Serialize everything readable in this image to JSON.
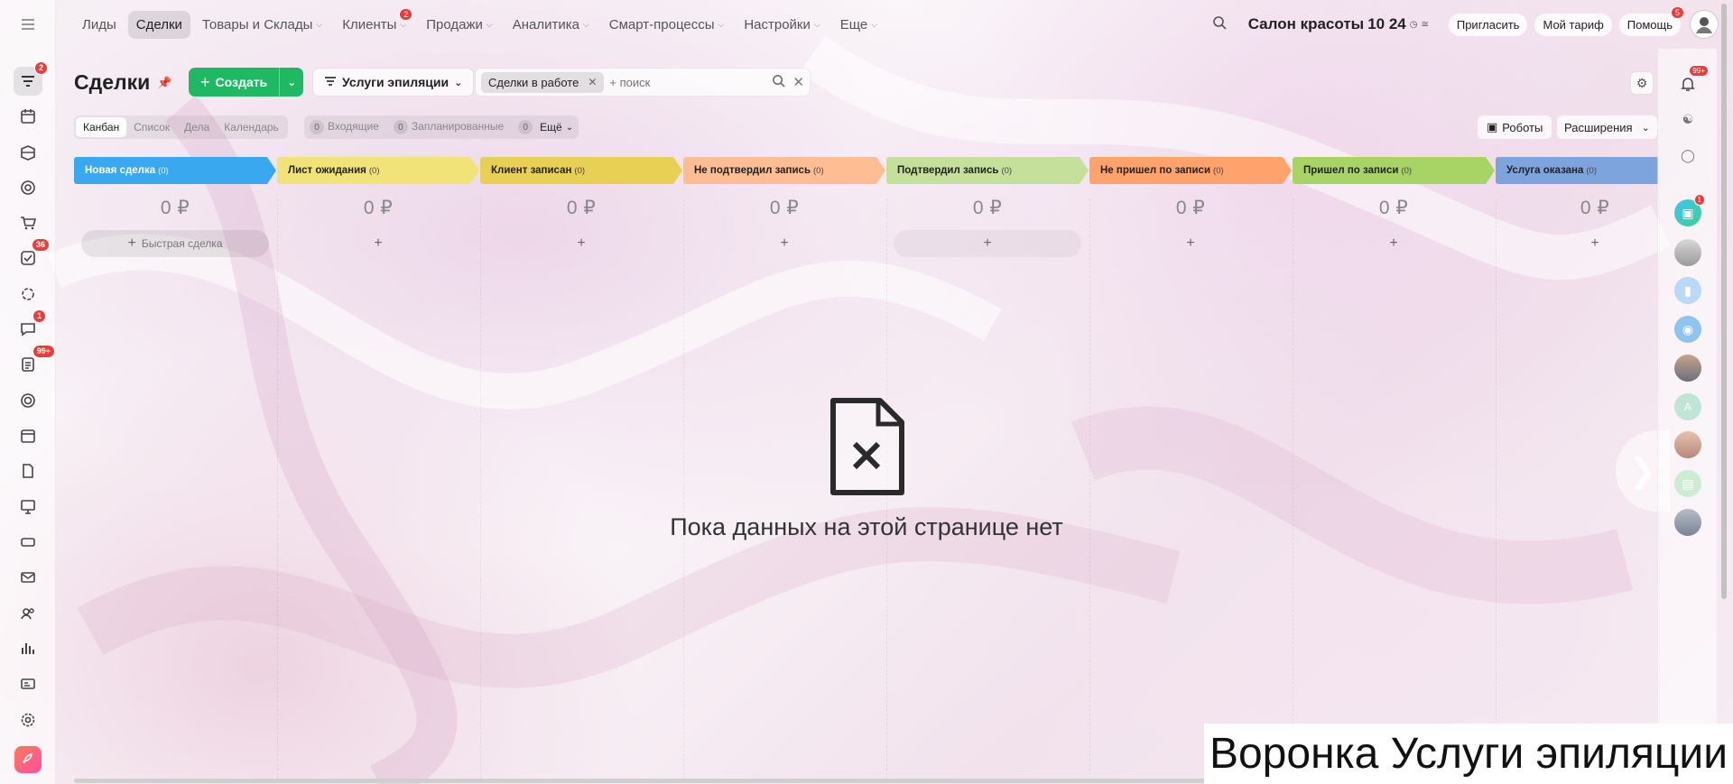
{
  "topnav": {
    "items": [
      {
        "label": "Лиды",
        "caret": false
      },
      {
        "label": "Сделки",
        "caret": false,
        "active": true
      },
      {
        "label": "Товары и Склады",
        "caret": true
      },
      {
        "label": "Клиенты",
        "caret": true,
        "badge": "2"
      },
      {
        "label": "Продажи",
        "caret": true
      },
      {
        "label": "Аналитика",
        "caret": true
      },
      {
        "label": "Смарт-процессы",
        "caret": true
      },
      {
        "label": "Настройки",
        "caret": true
      },
      {
        "label": "Еще",
        "caret": true
      }
    ]
  },
  "header": {
    "company": "Салон красоты",
    "time": "10 24",
    "invite": "Пригласить",
    "tariff": "Мой тариф",
    "help": "Помощь",
    "help_badge": "5"
  },
  "page": {
    "title": "Сделки",
    "create_label": "Создать",
    "funnel_label": "Услуги эпиляции",
    "filter_chip": "Сделки в работе",
    "search_placeholder": "+ поиск"
  },
  "view_tabs": [
    "Канбан",
    "Список",
    "Дела",
    "Календарь"
  ],
  "counters": {
    "incoming_count": "0",
    "incoming_label": "Входящие",
    "planned_count": "0",
    "planned_label": "Запланированные",
    "more_count": "0",
    "more_label": "Ещё"
  },
  "toolbar": {
    "robots_label": "Роботы",
    "extensions_label": "Расширения"
  },
  "kanban": {
    "quick_deal_label": "Быстрая сделка",
    "columns": [
      {
        "name": "Новая сделка",
        "count": "(0)",
        "sum": "0 ₽",
        "color": "#39a8ef"
      },
      {
        "name": "Лист ожидания",
        "count": "(0)",
        "sum": "0 ₽",
        "color": "#f2e378"
      },
      {
        "name": "Клиент записан",
        "count": "(0)",
        "sum": "0 ₽",
        "color": "#e8d054"
      },
      {
        "name": "Не подтвердил запись",
        "count": "(0)",
        "sum": "0 ₽",
        "color": "#ffbd93"
      },
      {
        "name": "Подтвердил запись",
        "count": "(0)",
        "sum": "0 ₽",
        "color": "#c4e09a"
      },
      {
        "name": "Не пришел по записи",
        "count": "(0)",
        "sum": "0 ₽",
        "color": "#ffa26b"
      },
      {
        "name": "Пришел по записи",
        "count": "(0)",
        "sum": "0 ₽",
        "color": "#a8d466"
      },
      {
        "name": "Услуга оказана",
        "count": "(0)",
        "sum": "0 ₽",
        "color": "#7ea4dd"
      }
    ]
  },
  "empty_state": {
    "text": "Пока данных на этой странице нет"
  },
  "sidebar_badges": {
    "feed": "2",
    "tasks": "36",
    "chat": "1",
    "docs": "99+"
  },
  "right_sidebar": {
    "notifications_badge": "99+",
    "chat_badge": "1",
    "contact_letter": "А"
  },
  "caption": "Воронка Услуги эпиляции"
}
